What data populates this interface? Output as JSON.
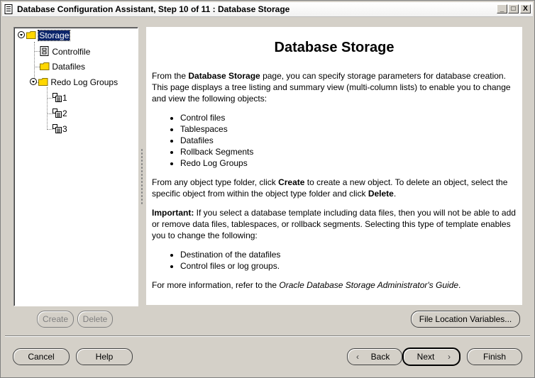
{
  "window": {
    "title": "Database Configuration Assistant, Step 10 of 11 : Database Storage",
    "controls": {
      "minimize": "_",
      "maximize": "□",
      "close": "X"
    }
  },
  "tree": {
    "root": "Storage",
    "items": [
      "Controlfile",
      "Datafiles",
      "Redo Log Groups"
    ],
    "redo_children": [
      "1",
      "2",
      "3"
    ]
  },
  "content": {
    "heading": "Database Storage",
    "p1_a": "From the ",
    "p1_b": "Database Storage",
    "p1_c": " page, you can specify storage parameters for database creation. This page displays a tree listing and summary view (multi-column lists) to enable you to change and view the following objects:",
    "list1": [
      "Control files",
      "Tablespaces",
      "Datafiles",
      "Rollback Segments",
      "Redo Log Groups"
    ],
    "p2_a": "From any object type folder, click ",
    "p2_b": "Create",
    "p2_c": " to create a new object. To delete an object, select the specific object from within the object type folder and click ",
    "p2_d": "Delete",
    "p2_e": ".",
    "p3_a": "Important:",
    "p3_b": " If you select a database template including data files, then you will not be able to add or remove data files, tablespaces, or rollback segments. Selecting this type of template enables you to change the following:",
    "list2": [
      "Destination of the datafiles",
      "Control files or log groups."
    ],
    "p4_a": "For more information, refer to the ",
    "p4_b": "Oracle Database Storage Administrator's Guide",
    "p4_c": "."
  },
  "buttons": {
    "create": "Create",
    "delete": "Delete",
    "file_location": "File Location Variables...",
    "cancel": "Cancel",
    "help": "Help",
    "back": "Back",
    "next": "Next",
    "finish": "Finish"
  }
}
